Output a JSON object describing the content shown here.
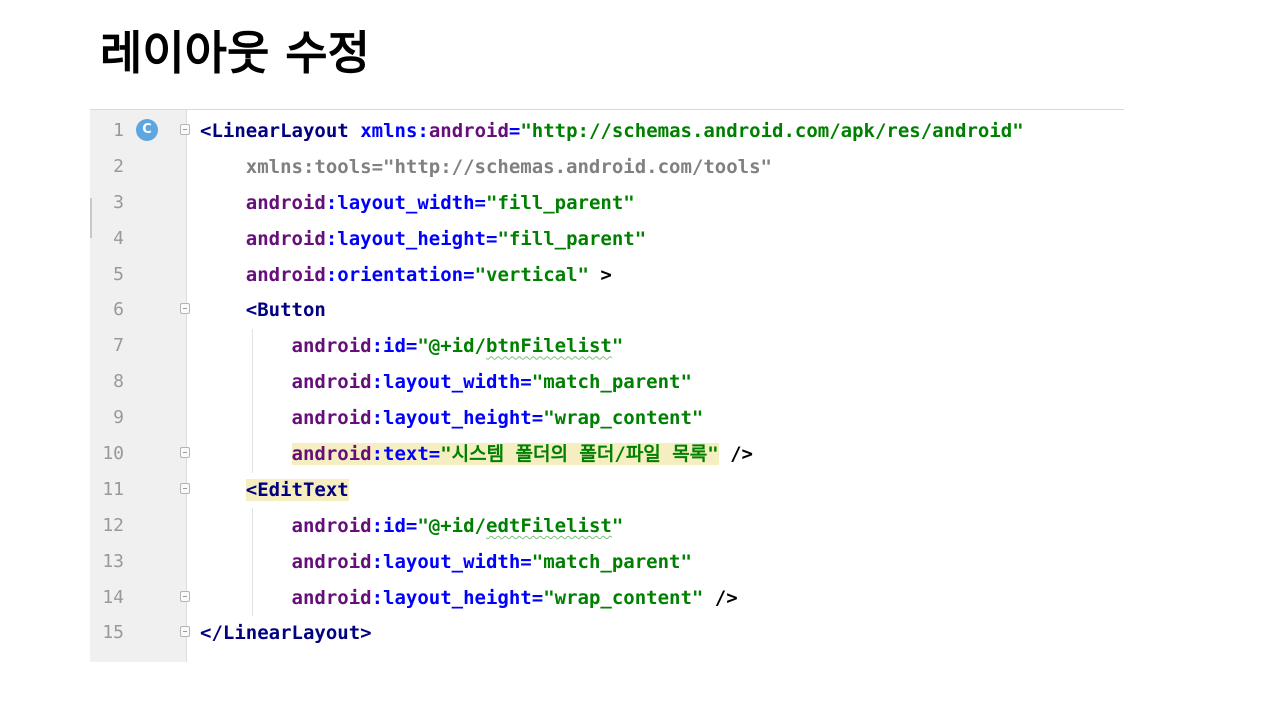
{
  "slide": {
    "title": "레이아웃 수정"
  },
  "editor": {
    "gutter_icon": "C",
    "lines": [
      {
        "num": "1",
        "fold": true,
        "icon": true,
        "indent": "",
        "tokens": [
          {
            "t": "<",
            "c": "tag"
          },
          {
            "t": "LinearLayout",
            "c": "tag"
          },
          {
            "t": " ",
            "c": "p"
          },
          {
            "t": "xmlns:",
            "c": "attr"
          },
          {
            "t": "android",
            "c": "ns"
          },
          {
            "t": "=",
            "c": "attr"
          },
          {
            "t": "\"http://schemas.android.com/apk/res/android\"",
            "c": "val"
          }
        ]
      },
      {
        "num": "2",
        "fold": false,
        "indent": "    ",
        "tokens": [
          {
            "t": "xmlns:tools=\"http://schemas.android.com/tools\"",
            "c": "gray"
          }
        ]
      },
      {
        "num": "3",
        "fold": false,
        "indent": "    ",
        "tokens": [
          {
            "t": "android",
            "c": "ns"
          },
          {
            "t": ":layout_width=",
            "c": "attr"
          },
          {
            "t": "\"fill_parent\"",
            "c": "val"
          }
        ]
      },
      {
        "num": "4",
        "fold": false,
        "indent": "    ",
        "tokens": [
          {
            "t": "android",
            "c": "ns"
          },
          {
            "t": ":layout_height=",
            "c": "attr"
          },
          {
            "t": "\"fill_parent\"",
            "c": "val"
          }
        ]
      },
      {
        "num": "5",
        "fold": false,
        "indent": "    ",
        "tokens": [
          {
            "t": "android",
            "c": "ns"
          },
          {
            "t": ":orientation=",
            "c": "attr"
          },
          {
            "t": "\"vertical\"",
            "c": "val"
          },
          {
            "t": " >",
            "c": "p"
          }
        ]
      },
      {
        "num": "6",
        "fold": true,
        "indent": "    ",
        "tokens": [
          {
            "t": "<Button",
            "c": "tag"
          }
        ]
      },
      {
        "num": "7",
        "fold": false,
        "indent": "        ",
        "tokens": [
          {
            "t": "android",
            "c": "ns"
          },
          {
            "t": ":id=",
            "c": "attr"
          },
          {
            "t": "\"@+id/",
            "c": "val"
          },
          {
            "t": "btnFilelist",
            "c": "val wavy"
          },
          {
            "t": "\"",
            "c": "val"
          }
        ]
      },
      {
        "num": "8",
        "fold": false,
        "indent": "        ",
        "tokens": [
          {
            "t": "android",
            "c": "ns"
          },
          {
            "t": ":layout_width=",
            "c": "attr"
          },
          {
            "t": "\"match_parent\"",
            "c": "val"
          }
        ]
      },
      {
        "num": "9",
        "fold": false,
        "indent": "        ",
        "tokens": [
          {
            "t": "android",
            "c": "ns"
          },
          {
            "t": ":layout_height=",
            "c": "attr"
          },
          {
            "t": "\"wrap_content\"",
            "c": "val"
          }
        ]
      },
      {
        "num": "10",
        "fold": true,
        "indent": "        ",
        "tokens": [
          {
            "t": "android",
            "c": "ns hl"
          },
          {
            "t": ":text=",
            "c": "attr hl"
          },
          {
            "t": "\"시스템 폴더의 폴더/파일 목록\"",
            "c": "val hl"
          },
          {
            "t": " />",
            "c": "p"
          }
        ]
      },
      {
        "num": "11",
        "fold": true,
        "indent": "    ",
        "tokens": [
          {
            "t": "<EditText",
            "c": "tag hl"
          }
        ]
      },
      {
        "num": "12",
        "fold": false,
        "indent": "        ",
        "tokens": [
          {
            "t": "android",
            "c": "ns"
          },
          {
            "t": ":id=",
            "c": "attr"
          },
          {
            "t": "\"@+id/",
            "c": "val"
          },
          {
            "t": "edtFilelist",
            "c": "val wavy"
          },
          {
            "t": "\"",
            "c": "val"
          }
        ]
      },
      {
        "num": "13",
        "fold": false,
        "indent": "        ",
        "tokens": [
          {
            "t": "android",
            "c": "ns"
          },
          {
            "t": ":layout_width=",
            "c": "attr"
          },
          {
            "t": "\"match_parent\"",
            "c": "val"
          }
        ]
      },
      {
        "num": "14",
        "fold": true,
        "indent": "        ",
        "tokens": [
          {
            "t": "android",
            "c": "ns"
          },
          {
            "t": ":layout_height=",
            "c": "attr"
          },
          {
            "t": "\"wrap_content\"",
            "c": "val"
          },
          {
            "t": " />",
            "c": "p"
          }
        ]
      },
      {
        "num": "15",
        "fold": true,
        "indent": "",
        "tokens": [
          {
            "t": "</LinearLayout>",
            "c": "tag"
          }
        ]
      }
    ]
  }
}
